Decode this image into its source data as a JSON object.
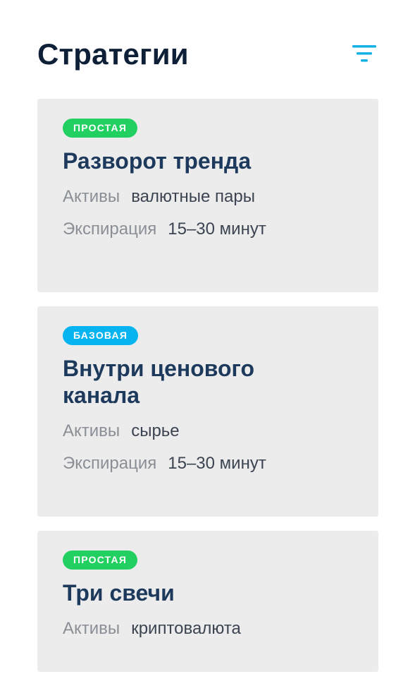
{
  "header": {
    "title": "Стратегии",
    "filter_icon": "filter-icon"
  },
  "colors": {
    "title": "#0d2038",
    "card_title": "#1d3a5c",
    "card_bg": "#ececed",
    "badge_simple": "#22d061",
    "badge_basic": "#08b4ef",
    "filter_accent": "#15b0e6"
  },
  "strategies": [
    {
      "badge": "ПРОСТАЯ",
      "title": "Разворот тренда",
      "assets_label": "Активы",
      "assets_value": "валютные пары",
      "expiration_label": "Экспирация",
      "expiration_value": "15–30 минут"
    },
    {
      "badge": "БАЗОВАЯ",
      "title": "Внутри ценового канала",
      "assets_label": "Активы",
      "assets_value": "сырье",
      "expiration_label": "Экспирация",
      "expiration_value": "15–30 минут"
    },
    {
      "badge": "ПРОСТАЯ",
      "title": "Три свечи",
      "assets_label": "Активы",
      "assets_value": "криптовалюта"
    }
  ]
}
